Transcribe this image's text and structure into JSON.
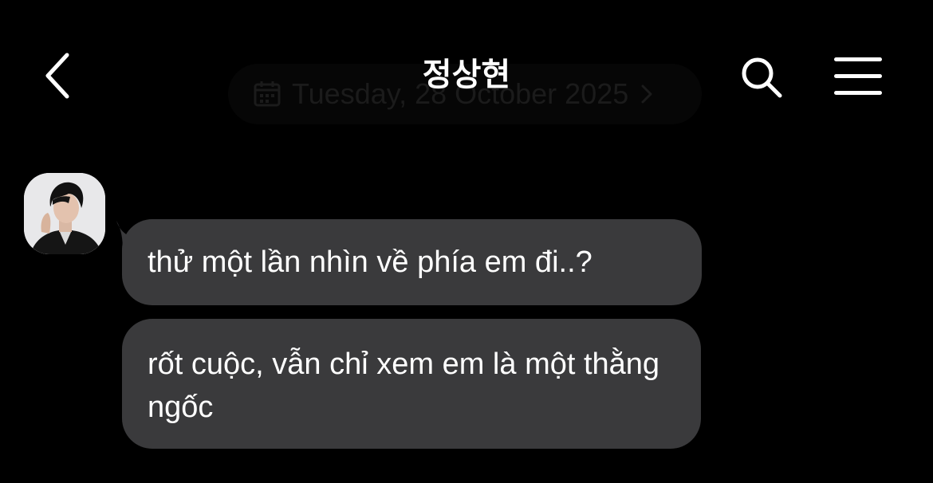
{
  "header": {
    "title": "정상현",
    "date_label": "Tuesday, 28 October 2025"
  },
  "icons": {
    "back": "chevron-left-icon",
    "search": "search-icon",
    "menu": "hamburger-menu-icon",
    "calendar": "calendar-icon"
  },
  "messages": [
    {
      "sender": "incoming",
      "text": "thử một lần nhìn về phía em đi..?"
    },
    {
      "sender": "incoming",
      "text": "rốt cuộc, vẫn chỉ xem em là một thằng ngốc"
    }
  ],
  "colors": {
    "background": "#000000",
    "bubble": "#3a3a3c",
    "text": "#ffffff"
  }
}
